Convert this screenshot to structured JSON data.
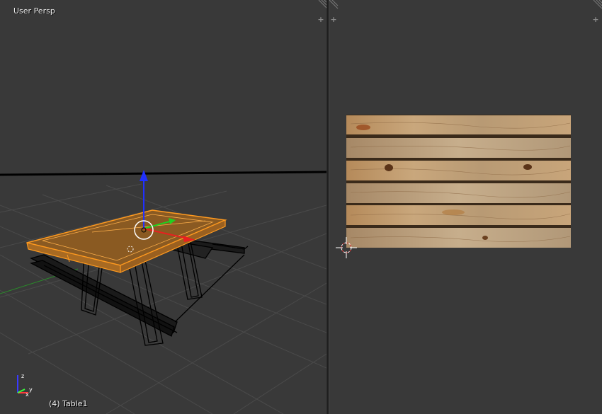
{
  "left_view": {
    "title": "User Persp",
    "status": "(4) Table1",
    "gizmo_axis_x": "x",
    "gizmo_axis_y": "y",
    "gizmo_axis_z": "z"
  },
  "right_view": {
    "image_name": "wood-planks-texture"
  },
  "icons": {
    "split_widget": "corner-hatch-icon",
    "area_plus": "plus-icon"
  },
  "colors": {
    "background": "#393939",
    "selection_orange": "#ff9a1f",
    "axis_x": "#ff2020",
    "axis_y": "#20e020",
    "axis_z": "#2020ff"
  }
}
